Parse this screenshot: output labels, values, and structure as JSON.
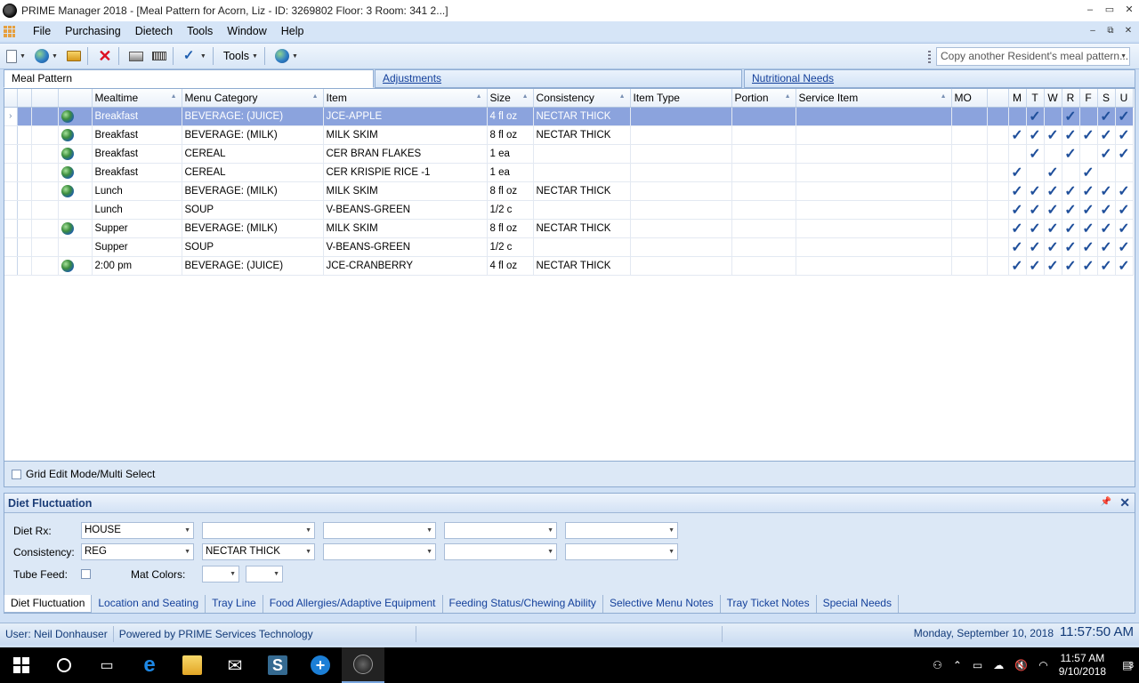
{
  "window": {
    "title": "PRIME Manager 2018 - [Meal Pattern for Acorn, Liz - ID: 3269802 Floor: 3 Room: 341 2...]",
    "minimize": "‒",
    "maximize": "▭",
    "close": "✕"
  },
  "menubar": {
    "items": [
      "File",
      "Purchasing",
      "Dietech",
      "Tools",
      "Window",
      "Help"
    ],
    "mdi_min": "‒",
    "mdi_restore": "⧉",
    "mdi_close": "✕"
  },
  "toolbar": {
    "tools_label": "Tools",
    "copy_placeholder": "Copy another Resident's meal pattern..."
  },
  "top_tabs": [
    "Meal Pattern",
    "Adjustments",
    "Nutritional Needs"
  ],
  "grid": {
    "columns": [
      "Mealtime",
      "Menu Category",
      "Item",
      "Size",
      "Consistency",
      "Item Type",
      "Portion",
      "Service Item",
      "MO"
    ],
    "days": [
      "M",
      "T",
      "W",
      "R",
      "F",
      "S",
      "U"
    ],
    "check_glyph": "✓",
    "row_pointer": "›",
    "rows": [
      {
        "globe": true,
        "mealtime": "Breakfast",
        "category": "BEVERAGE: (JUICE)",
        "item": "JCE-APPLE",
        "size": "4 fl oz",
        "consistency": "NECTAR THICK",
        "days": [
          false,
          true,
          false,
          true,
          false,
          true,
          true
        ]
      },
      {
        "globe": true,
        "mealtime": "Breakfast",
        "category": "BEVERAGE: (MILK)",
        "item": "MILK SKIM",
        "size": "8 fl oz",
        "consistency": "NECTAR THICK",
        "days": [
          true,
          true,
          true,
          true,
          true,
          true,
          true
        ]
      },
      {
        "globe": true,
        "mealtime": "Breakfast",
        "category": "CEREAL",
        "item": "CER BRAN FLAKES",
        "size": "1 ea",
        "consistency": "",
        "days": [
          false,
          true,
          false,
          true,
          false,
          true,
          true
        ]
      },
      {
        "globe": true,
        "mealtime": "Breakfast",
        "category": "CEREAL",
        "item": "CER KRISPIE RICE -1",
        "size": "1 ea",
        "consistency": "",
        "days": [
          true,
          false,
          true,
          false,
          true,
          false,
          false
        ]
      },
      {
        "globe": true,
        "mealtime": "Lunch",
        "category": "BEVERAGE: (MILK)",
        "item": "MILK SKIM",
        "size": "8 fl oz",
        "consistency": "NECTAR THICK",
        "days": [
          true,
          true,
          true,
          true,
          true,
          true,
          true
        ]
      },
      {
        "globe": false,
        "mealtime": "Lunch",
        "category": "SOUP",
        "item": "V-BEANS-GREEN",
        "size": "1/2 c",
        "consistency": "",
        "days": [
          true,
          true,
          true,
          true,
          true,
          true,
          true
        ]
      },
      {
        "globe": true,
        "mealtime": "Supper",
        "category": "BEVERAGE: (MILK)",
        "item": "MILK SKIM",
        "size": "8 fl oz",
        "consistency": "NECTAR THICK",
        "days": [
          true,
          true,
          true,
          true,
          true,
          true,
          true
        ]
      },
      {
        "globe": false,
        "mealtime": "Supper",
        "category": "SOUP",
        "item": "V-BEANS-GREEN",
        "size": "1/2 c",
        "consistency": "",
        "days": [
          true,
          true,
          true,
          true,
          true,
          true,
          true
        ]
      },
      {
        "globe": true,
        "mealtime": "2:00 pm",
        "category": "BEVERAGE: (JUICE)",
        "item": "JCE-CRANBERRY",
        "size": "4 fl oz",
        "consistency": "NECTAR THICK",
        "days": [
          true,
          true,
          true,
          true,
          true,
          true,
          true
        ]
      }
    ]
  },
  "grid_edit_label": "Grid Edit Mode/Multi Select",
  "diet": {
    "title": "Diet Fluctuation",
    "diet_rx_label": "Diet Rx:",
    "diet_rx": [
      "HOUSE",
      "",
      "",
      "",
      ""
    ],
    "consistency_label": "Consistency:",
    "consistency": [
      "REG",
      "NECTAR THICK",
      "",
      "",
      ""
    ],
    "tube_feed_label": "Tube Feed:",
    "mat_colors_label": "Mat Colors:"
  },
  "bottom_tabs": [
    "Diet Fluctuation",
    "Location and Seating",
    "Tray Line",
    "Food Allergies/Adaptive Equipment",
    "Feeding Status/Chewing Ability",
    "Selective Menu Notes",
    "Tray Ticket Notes",
    "Special Needs"
  ],
  "status": {
    "user": "User: Neil Donhauser",
    "powered": "Powered by PRIME Services Technology",
    "date": "Monday, September 10, 2018",
    "time": "11:57:50 AM"
  },
  "taskbar": {
    "clock_time": "11:57 AM",
    "clock_date": "9/10/2018",
    "notifications": "3"
  }
}
